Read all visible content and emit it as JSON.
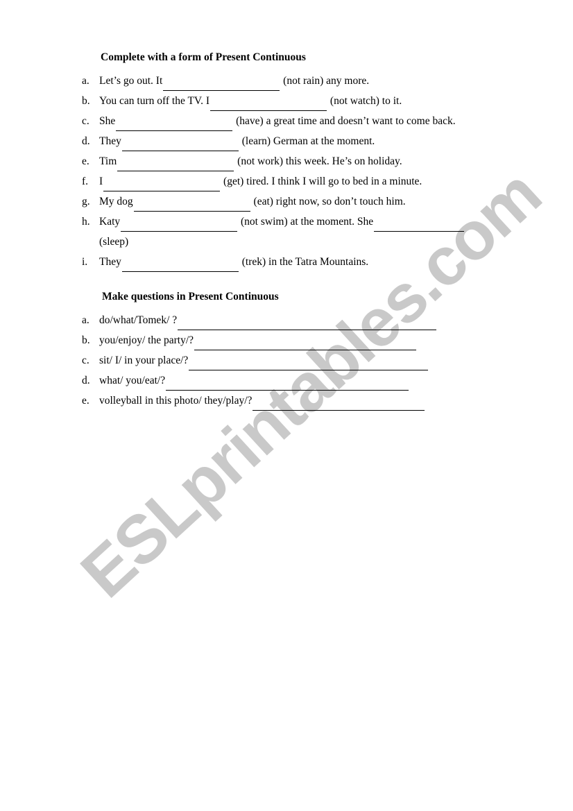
{
  "watermark": {
    "text": "ESLprintables.com",
    "color": "#c9c9c9"
  },
  "sections": [
    {
      "id": "complete",
      "heading": "Complete with a form of Present Continuous",
      "items": [
        {
          "marker": "a.",
          "before": "Let’s go out. It",
          "blank_width": 168,
          "after": "(not rain) any more."
        },
        {
          "marker": "b.",
          "before": "You can turn off the TV. I",
          "blank_width": 168,
          "after": "(not watch) to it."
        },
        {
          "marker": "c.",
          "before": "She",
          "blank_width": 168,
          "after": "(have) a great time and doesn’t want to come back."
        },
        {
          "marker": "d.",
          "before": "They",
          "blank_width": 168,
          "after": "(learn) German at the moment."
        },
        {
          "marker": "e.",
          "before": "Tim",
          "blank_width": 168,
          "after": "(not work) this week. He’s on holiday."
        },
        {
          "marker": "f.",
          "before": "I",
          "blank_width": 168,
          "after": "(get) tired. I think I will go to bed in a minute."
        },
        {
          "marker": "g.",
          "before": "My dog",
          "blank_width": 168,
          "after": "(eat) right now, so don’t touch him."
        },
        {
          "marker": "h.",
          "before": "Katy",
          "blank_width": 168,
          "after": "(not swim) at the moment. She",
          "blank2_width": 130,
          "continuation": "(sleep)"
        },
        {
          "marker": "i.",
          "before": "They",
          "blank_width": 168,
          "after": "(trek) in the Tatra Mountains."
        }
      ]
    },
    {
      "id": "questions",
      "heading": "Make questions in Present Continuous",
      "items": [
        {
          "marker": "a.",
          "before": "do/what/Tomek/ ?",
          "blank_width": 373
        },
        {
          "marker": "b.",
          "before": "you/enjoy/ the party/?",
          "blank_width": 320
        },
        {
          "marker": "c.",
          "before": "sit/ I/ in your place/?",
          "blank_width": 345
        },
        {
          "marker": "d.",
          "before": "what/ you/eat/?",
          "blank_width": 350
        },
        {
          "marker": "e.",
          "before": "volleyball in this photo/ they/play/?",
          "blank_width": 248
        }
      ]
    }
  ]
}
